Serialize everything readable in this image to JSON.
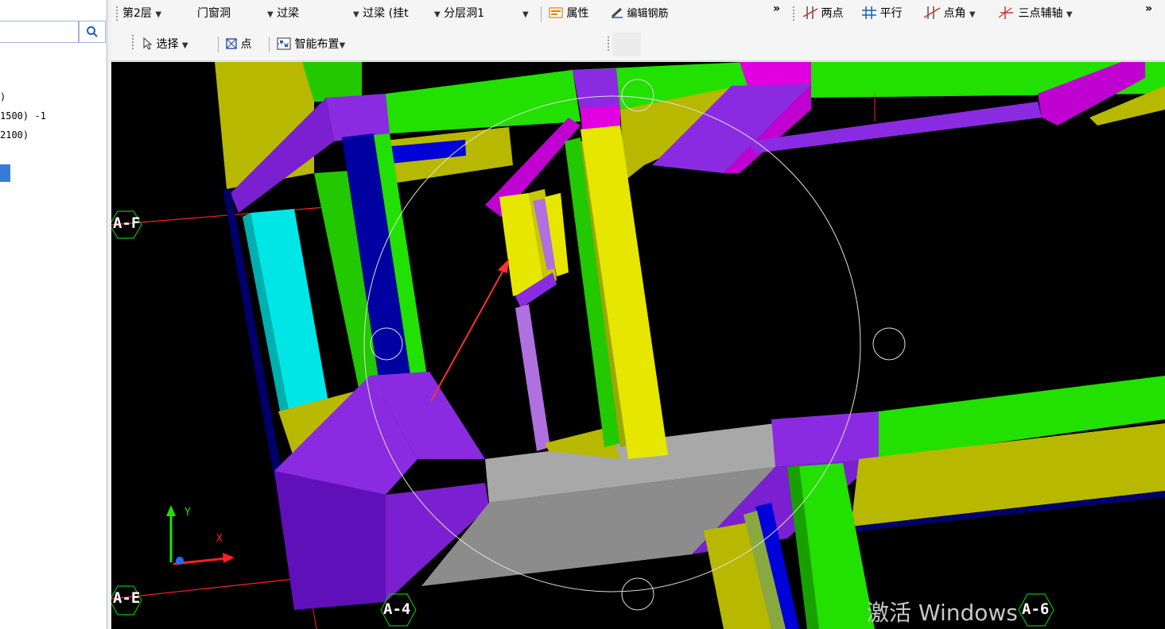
{
  "left_panel": {
    "lines": [
      ")",
      "1500) -1",
      "2100)"
    ]
  },
  "toolbar1": {
    "floor": "第2层",
    "category": "门窗洞",
    "component": "过梁",
    "component_type": "过梁 (挂t",
    "instance": "分层洞1",
    "properties": "属性",
    "edit_rebar": "编辑钢筋",
    "two_point": "两点",
    "parallel": "平行",
    "point_angle": "点角",
    "three_point_axis": "三点辅轴",
    "more": "»"
  },
  "toolbar2": {
    "select": "选择",
    "point": "点",
    "smart_layout": "智能布置"
  },
  "viewport": {
    "axis_labels": {
      "a_f": "A-F",
      "a_e": "A-E",
      "a_4": "A-4",
      "a_6": "A-6"
    },
    "ucs_y": "Y",
    "ucs_x": "X",
    "watermark": "激活 Windows"
  },
  "colors": {
    "beam_green": "#22e000",
    "column_yellow": "#e6e600",
    "lintel_purple": "#8a2be2",
    "magenta": "#e000e0",
    "cyan": "#00e6e6",
    "grey_slab": "#a8a8a8",
    "olive": "#b8b800",
    "axis_red": "#ff2020"
  }
}
